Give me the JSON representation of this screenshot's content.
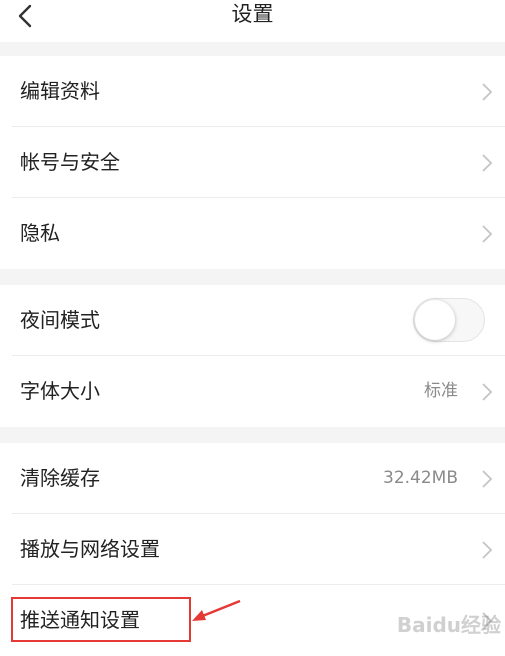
{
  "header": {
    "title": "设置",
    "back_icon": "chevron-left-icon"
  },
  "groups": [
    {
      "items": [
        {
          "label": "编辑资料",
          "value": "",
          "control": "chevron"
        },
        {
          "label": "帐号与安全",
          "value": "",
          "control": "chevron"
        },
        {
          "label": "隐私",
          "value": "",
          "control": "chevron"
        }
      ]
    },
    {
      "items": [
        {
          "label": "夜间模式",
          "value": "",
          "control": "toggle",
          "toggle_on": false
        },
        {
          "label": "字体大小",
          "value": "标准",
          "control": "chevron"
        }
      ]
    },
    {
      "items": [
        {
          "label": "清除缓存",
          "value": "32.42MB",
          "control": "chevron"
        },
        {
          "label": "播放与网络设置",
          "value": "",
          "control": "chevron"
        },
        {
          "label": "推送通知设置",
          "value": "",
          "control": "chevron"
        }
      ]
    }
  ],
  "annotation": {
    "highlighted_item": "推送通知设置",
    "color": "#e53935"
  },
  "watermark": "Baidu经验"
}
